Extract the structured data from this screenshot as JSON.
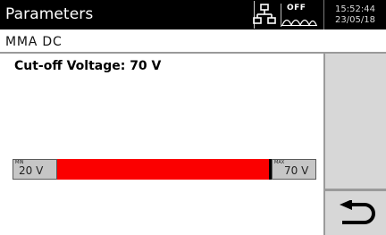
{
  "header": {
    "title": "Parameters",
    "status": {
      "network_icon": "network-icon",
      "output_state": "OFF",
      "output_icon": "arc-wave-icon"
    },
    "clock": {
      "time": "15:52:44",
      "date": "23/05/18"
    }
  },
  "mode": {
    "label": "MMA DC"
  },
  "parameter": {
    "heading": "Cut-off Voltage: 70 V",
    "min_tag": "MIN",
    "min_value": "20 V",
    "max_tag": "MAX",
    "max_value": "70 V",
    "level_fraction": 1.0,
    "fill_color": "#fb0000"
  },
  "nav": {
    "back_icon": "return-arrow-icon"
  }
}
